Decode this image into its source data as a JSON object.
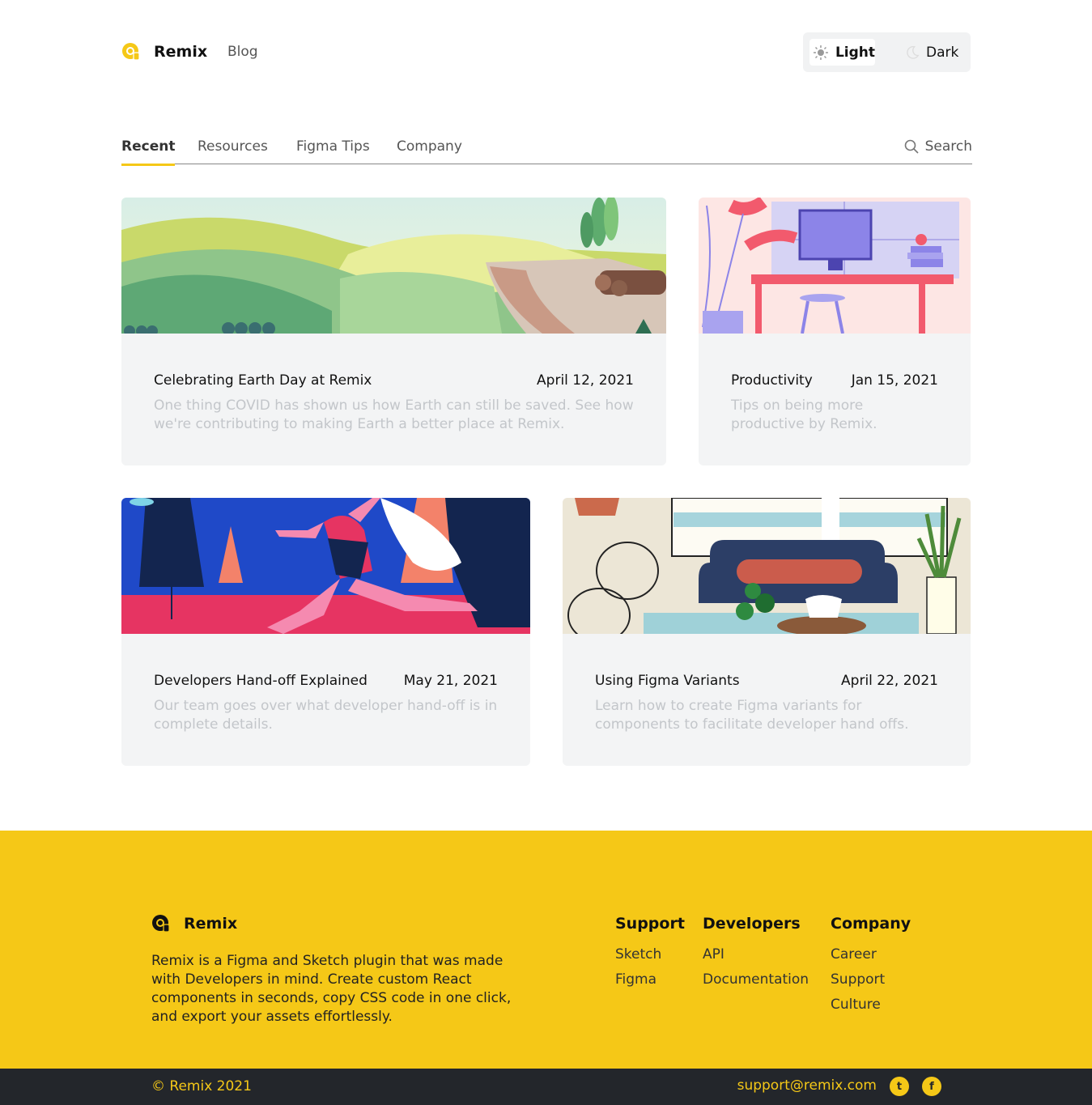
{
  "header": {
    "brand": "Remix",
    "blog_link": "Blog",
    "theme": {
      "light_label": "Light",
      "dark_label": "Dark",
      "selected": "Light"
    }
  },
  "tabs": {
    "items": [
      {
        "label": "Recent",
        "active": true
      },
      {
        "label": "Resources",
        "active": false
      },
      {
        "label": "Figma Tips",
        "active": false
      },
      {
        "label": "Company",
        "active": false
      }
    ],
    "search_label": "Search"
  },
  "posts": [
    {
      "title": "Celebrating Earth Day at Remix",
      "date": "April 12, 2021",
      "description": "One thing COVID has shown us how Earth can still be saved. See how we're contributing to making Earth a better place at Remix."
    },
    {
      "title": "Productivity",
      "date": "Jan 15, 2021",
      "description": "Tips on being more productive by Remix."
    },
    {
      "title": "Developers Hand-off Explained",
      "date": "May 21, 2021",
      "description": "Our team goes over what developer hand-off is in complete details."
    },
    {
      "title": "Using Figma Variants",
      "date": "April 22, 2021",
      "description": "Learn how to create Figma variants for components to facilitate developer hand offs."
    }
  ],
  "footer": {
    "brand": "Remix",
    "description": "Remix is a Figma and Sketch plugin that was made with Developers in mind. Create custom React components in seconds, copy CSS code in one click, and export your assets effortlessly.",
    "columns": [
      {
        "heading": "Support",
        "links": [
          "Sketch",
          "Figma"
        ]
      },
      {
        "heading": "Developers",
        "links": [
          "API",
          "Documentation"
        ]
      },
      {
        "heading": "Company",
        "links": [
          "Career",
          "Support",
          "Culture"
        ]
      }
    ],
    "copyright": "© Remix 2021",
    "email": "support@remix.com",
    "social": {
      "twitter_glyph": "t",
      "facebook_glyph": "f"
    }
  },
  "colors": {
    "accent": "#f5c817",
    "footer_bottom": "#23262b",
    "card_bg": "#f3f4f5",
    "muted_text": "#c3c6ca"
  }
}
